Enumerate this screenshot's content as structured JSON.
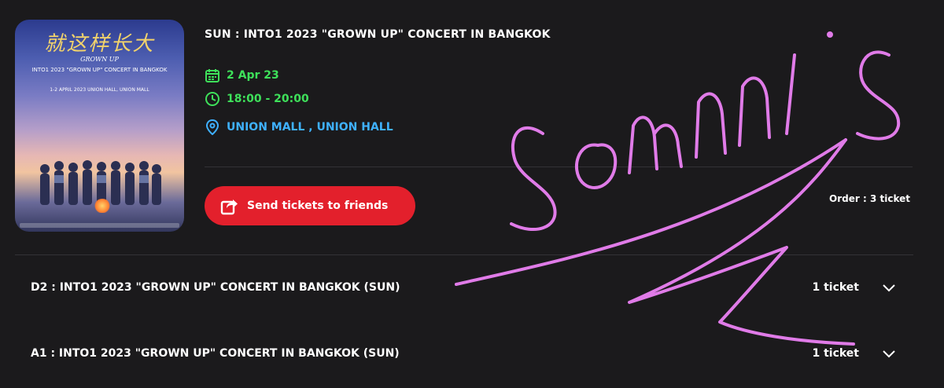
{
  "event": {
    "title": "SUN : INTO1 2023 \"GROWN UP\" CONCERT IN BANGKOK",
    "date": "2 Apr 23",
    "time": "18:00 - 20:00",
    "venue": "UNION MALL , UNION HALL",
    "send_button_label": "Send tickets to friends",
    "order_text": "Order : 3 ticket"
  },
  "poster": {
    "line1": "就这样长大",
    "line2": "GROWN UP",
    "line3": "INTO1 2023 \"GROWN UP\" CONCERT IN BANGKOK",
    "line4": "1-2 APRIL 2023 UNION HALL, UNION MALL"
  },
  "tickets": [
    {
      "name": "D2 : INTO1 2023 \"GROWN UP\" CONCERT IN BANGKOK (SUN)",
      "count": "1 ticket"
    },
    {
      "name": "A1 : INTO1 2023 \"GROWN UP\" CONCERT IN BANGKOK (SUN)",
      "count": "1 ticket"
    }
  ],
  "annotation": {
    "text": "somnis",
    "color": "#e07be8"
  },
  "colors": {
    "accent_red": "#e3202c",
    "green": "#3ee05a",
    "blue": "#3fb1ff",
    "background": "#1b1a1c"
  },
  "icons": {
    "date": "calendar-icon",
    "time": "clock-icon",
    "venue": "location-pin-icon",
    "send": "share-arrow-icon",
    "expand": "chevron-down-icon"
  }
}
